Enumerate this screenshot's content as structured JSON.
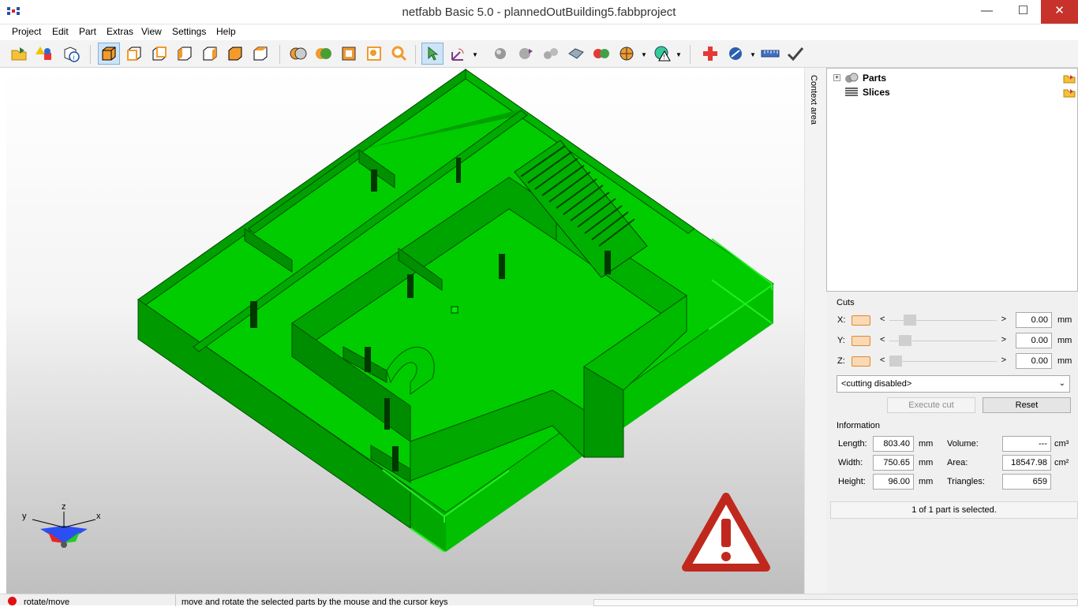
{
  "window": {
    "title": "netfabb Basic 5.0 - plannedOutBuilding5.fabbproject",
    "minimize": "—",
    "maximize": "☐",
    "close": "✕"
  },
  "menu": [
    "Project",
    "Edit",
    "Part",
    "Extras",
    "View",
    "Settings",
    "Help"
  ],
  "toolbar": {
    "icons": [
      "open-project-icon",
      "add-part-icon",
      "part-info-icon",
      "view-iso-icon",
      "view-front-icon",
      "view-back-icon",
      "view-left-icon",
      "view-right-icon",
      "view-top-icon",
      "view-bottom-icon",
      "colors-icon",
      "shading-icon",
      "bounding-box-icon",
      "zoom-all-icon",
      "zoom-icon",
      "select-pointer-icon",
      "rotate-move-icon",
      "sphere-icon",
      "move-icon",
      "arrange-icon",
      "scale-icon",
      "merge-icon",
      "cut-icon",
      "repair-icon",
      "add-repair-icon",
      "measure-icon",
      "ruler-icon",
      "apply-check-icon"
    ]
  },
  "context_area": {
    "label": "Context area"
  },
  "tree": {
    "items": [
      {
        "label": "Parts"
      },
      {
        "label": "Slices"
      }
    ]
  },
  "cuts": {
    "heading": "Cuts",
    "axes": [
      {
        "axis": "X:",
        "value": "0.00",
        "unit": "mm"
      },
      {
        "axis": "Y:",
        "value": "0.00",
        "unit": "mm"
      },
      {
        "axis": "Z:",
        "value": "0.00",
        "unit": "mm"
      }
    ],
    "mode": "<cutting disabled>",
    "execute_label": "Execute cut",
    "reset_label": "Reset"
  },
  "information": {
    "heading": "Information",
    "length": {
      "label": "Length:",
      "value": "803.40",
      "unit": "mm"
    },
    "width": {
      "label": "Width:",
      "value": "750.65",
      "unit": "mm"
    },
    "height": {
      "label": "Height:",
      "value": "96.00",
      "unit": "mm"
    },
    "volume": {
      "label": "Volume:",
      "value": "---",
      "unit": "cm³"
    },
    "area": {
      "label": "Area:",
      "value": "18547.98",
      "unit": "cm²"
    },
    "triangles": {
      "label": "Triangles:",
      "value": "659"
    }
  },
  "selection_status": "1 of 1 part is selected.",
  "axes_gizmo": {
    "x": "x",
    "y": "y",
    "z": "z"
  },
  "status": {
    "mode": "rotate/move",
    "hint": "move and rotate the selected parts by the mouse and the cursor keys"
  },
  "colors": {
    "model_green": "#00cc00",
    "warning_red": "#c0281e",
    "selection_blue": "#cde4f7"
  }
}
